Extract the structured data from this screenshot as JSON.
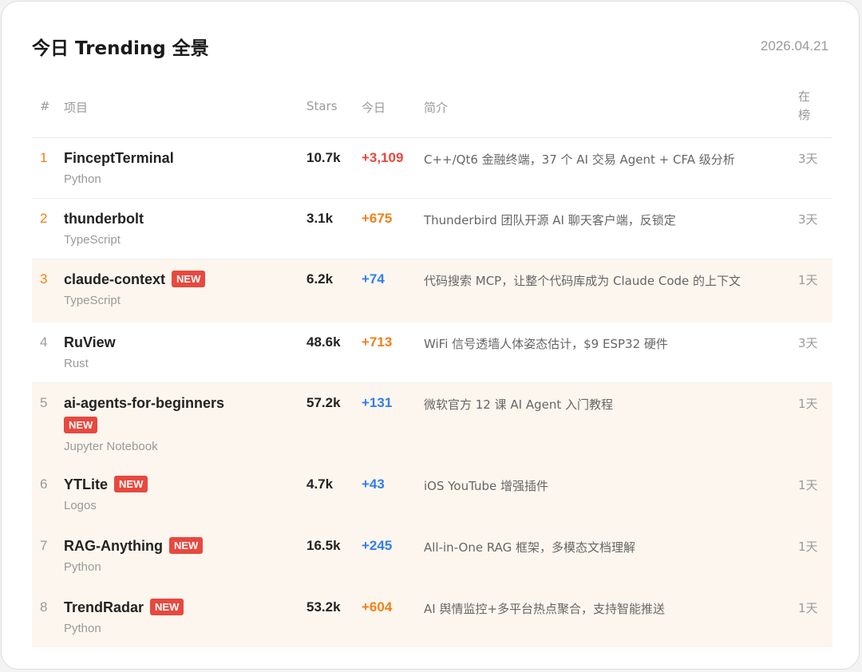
{
  "header": {
    "title": "今日 Trending 全景",
    "date": "2026.04.21"
  },
  "columns": {
    "rank": "#",
    "project": "项目",
    "stars": "Stars",
    "today": "今日",
    "desc": "简介",
    "onboard": "在榜"
  },
  "colors": {
    "red": "#e8483e",
    "orange": "#f08018",
    "blue": "#2f7ff0",
    "highlight": "#fdf6ee"
  },
  "rows": [
    {
      "rank": "1",
      "name": "FinceptTerminal",
      "badge": "",
      "lang": "Python",
      "stars": "10.7k",
      "today": "+3,109",
      "today_color": "red",
      "desc": "C++/Qt6 金融终端，37 个 AI 交易 Agent + CFA 级分析",
      "days": "3天",
      "highlighted": false
    },
    {
      "rank": "2",
      "name": "thunderbolt",
      "badge": "",
      "lang": "TypeScript",
      "stars": "3.1k",
      "today": "+675",
      "today_color": "orange",
      "desc": "Thunderbird 团队开源 AI 聊天客户端，反锁定",
      "days": "3天",
      "highlighted": false
    },
    {
      "rank": "3",
      "name": "claude-context",
      "badge": "NEW",
      "lang": "TypeScript",
      "stars": "6.2k",
      "today": "+74",
      "today_color": "blue",
      "desc": "代码搜索 MCP，让整个代码库成为 Claude Code 的上下文",
      "days": "1天",
      "highlighted": true
    },
    {
      "rank": "4",
      "name": "RuView",
      "badge": "",
      "lang": "Rust",
      "stars": "48.6k",
      "today": "+713",
      "today_color": "orange",
      "desc": "WiFi 信号透墙人体姿态估计，$9 ESP32 硬件",
      "days": "3天",
      "highlighted": false
    },
    {
      "rank": "5",
      "name": "ai-agents-for-beginners",
      "badge": "NEW",
      "lang": "Jupyter Notebook",
      "stars": "57.2k",
      "today": "+131",
      "today_color": "blue",
      "desc": "微软官方 12 课 AI Agent 入门教程",
      "days": "1天",
      "highlighted": true
    },
    {
      "rank": "6",
      "name": "YTLite",
      "badge": "NEW",
      "lang": "Logos",
      "stars": "4.7k",
      "today": "+43",
      "today_color": "blue",
      "desc": "iOS YouTube 增强插件",
      "days": "1天",
      "highlighted": true
    },
    {
      "rank": "7",
      "name": "RAG-Anything",
      "badge": "NEW",
      "lang": "Python",
      "stars": "16.5k",
      "today": "+245",
      "today_color": "blue",
      "desc": "All-in-One RAG 框架，多模态文档理解",
      "days": "1天",
      "highlighted": true
    },
    {
      "rank": "8",
      "name": "TrendRadar",
      "badge": "NEW",
      "lang": "Python",
      "stars": "53.2k",
      "today": "+604",
      "today_color": "orange",
      "desc": "AI 舆情监控+多平台热点聚合，支持智能推送",
      "days": "1天",
      "highlighted": true
    }
  ]
}
